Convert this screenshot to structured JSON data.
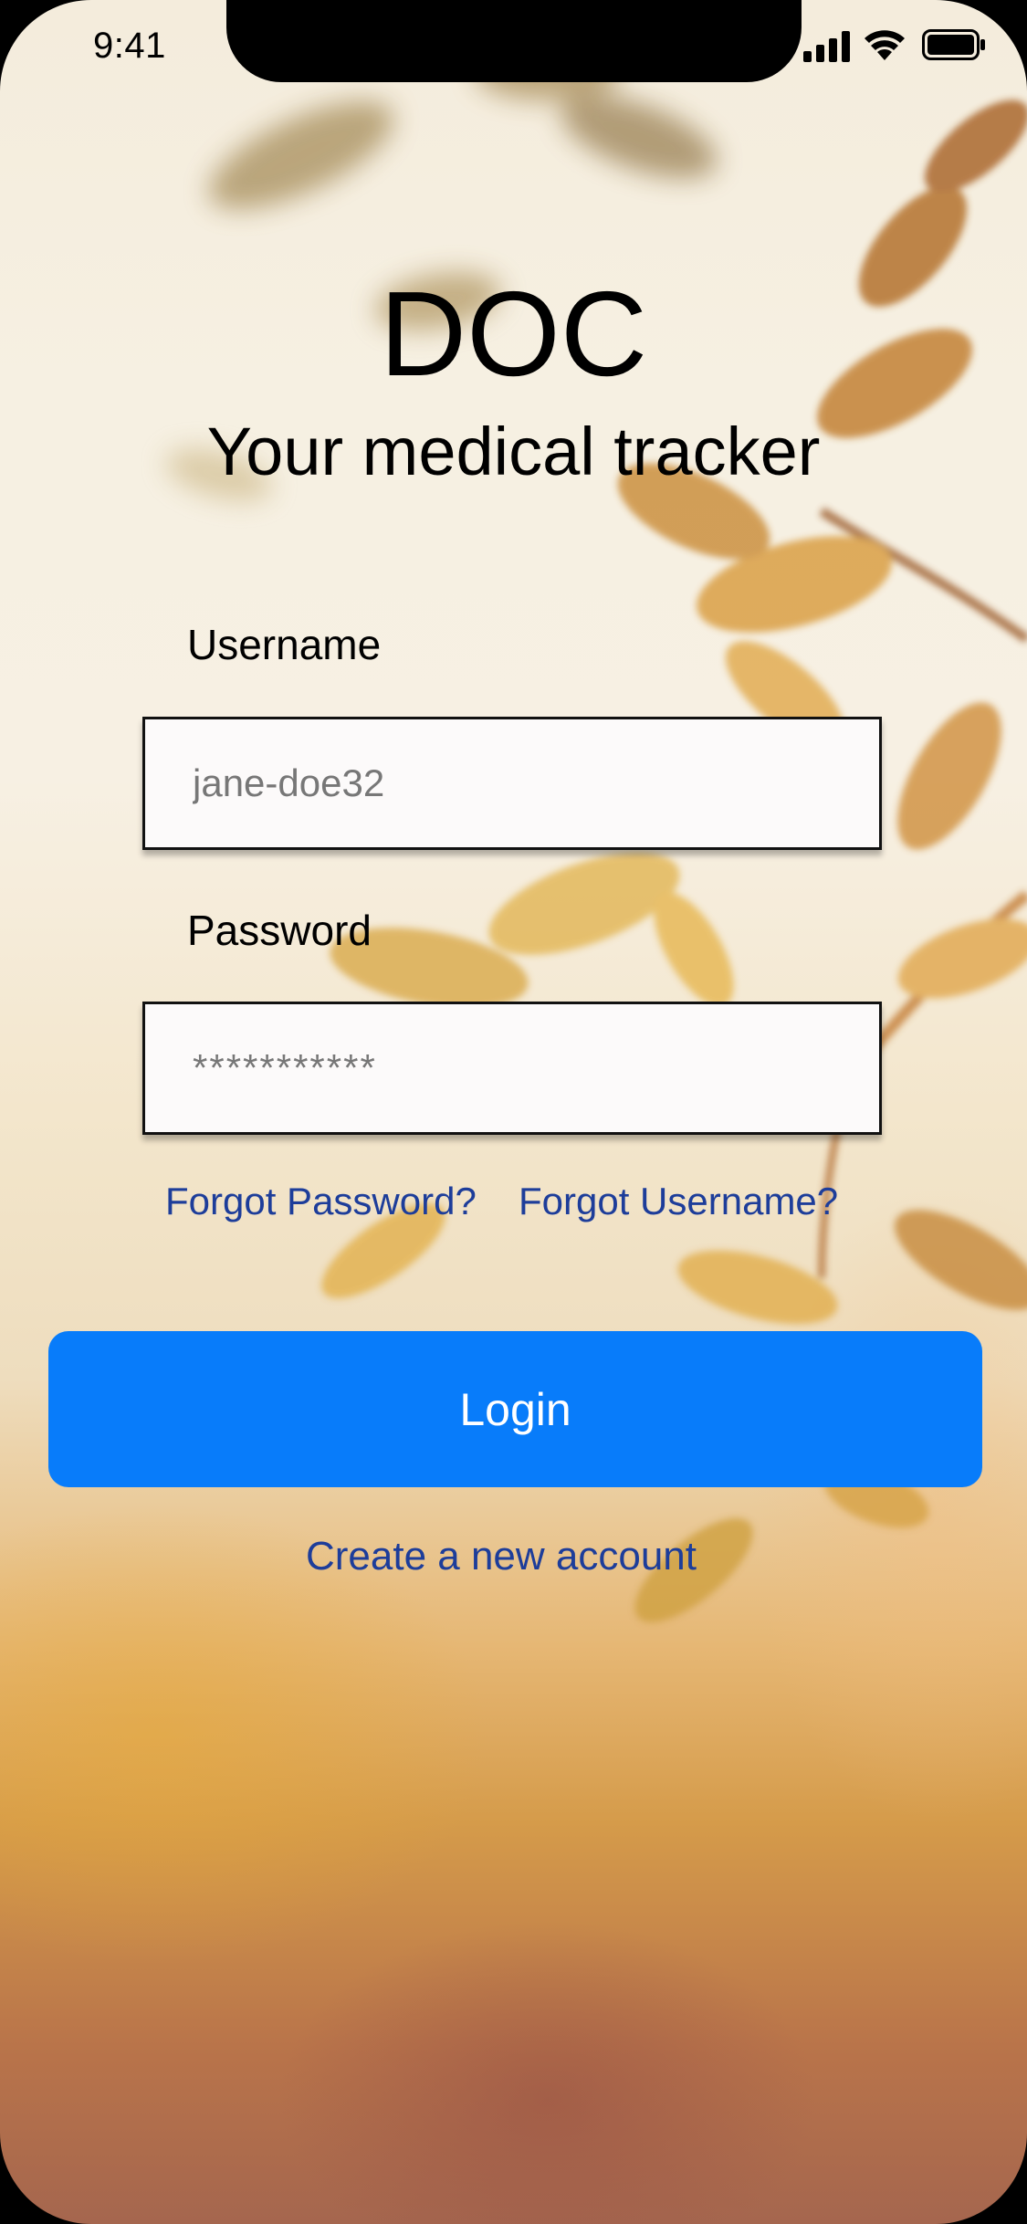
{
  "status_bar": {
    "time": "9:41",
    "icons": [
      "cellular-signal-icon",
      "wifi-icon",
      "battery-icon"
    ]
  },
  "header": {
    "title": "DOC",
    "subtitle": "Your medical tracker"
  },
  "form": {
    "username_label": "Username",
    "username_placeholder": "jane-doe32",
    "password_label": "Password",
    "password_placeholder": "***********"
  },
  "links": {
    "forgot_password": "Forgot Password?",
    "forgot_username": "Forgot Username?",
    "create_account": "Create a new account"
  },
  "actions": {
    "login_label": "Login"
  },
  "colors": {
    "accent": "#087cfa",
    "link": "#1d3d9a"
  }
}
